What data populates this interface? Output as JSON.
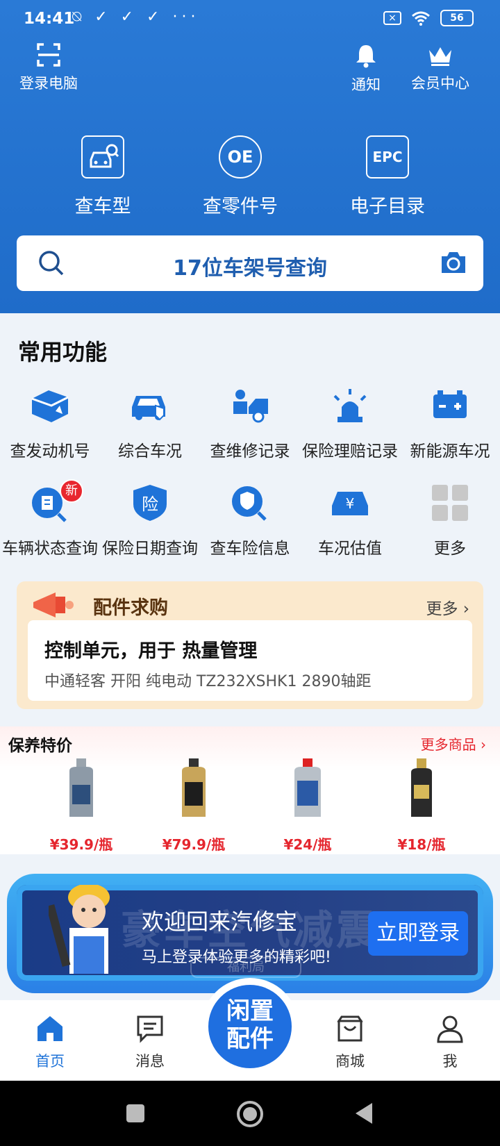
{
  "status": {
    "time": "14:41",
    "left_icons": "⍉ ✓ ✓ ✓ ···",
    "battery": "56"
  },
  "topnav": {
    "login_pc": "登录电脑",
    "notify": "通知",
    "member": "会员中心"
  },
  "quick": [
    {
      "label": "查车型",
      "icon_text": ""
    },
    {
      "label": "查零件号",
      "icon_text": "OE"
    },
    {
      "label": "电子目录",
      "icon_text": "EPC"
    }
  ],
  "search": {
    "text": "17位车架号查询"
  },
  "common": {
    "title": "常用功能",
    "row1": [
      "查发动机号",
      "综合车况",
      "查维修记录",
      "保险理赔记录",
      "新能源车况"
    ],
    "row2": [
      "车辆状态查询",
      "保险日期查询",
      "查车险信息",
      "车况估值",
      "更多"
    ],
    "badge": "新"
  },
  "parts": {
    "title": "配件求购",
    "more": "更多 ›",
    "item_title": "控制单元，用于 热量管理",
    "item_sub": "中通轻客 开阳 纯电动 TZ232XSHK1 2890轴距"
  },
  "maintenance": {
    "title": "保养特价",
    "more": "更多商品 ›",
    "prices": [
      "¥39.9/瓶",
      "¥79.9/瓶",
      "¥24/瓶",
      "¥18/瓶"
    ]
  },
  "banner": {
    "bg_text": "豪车空气减震",
    "welcome": "欢迎回来汽修宝",
    "sub": "马上登录体验更多的精彩吧!",
    "login_btn": "立即登录",
    "tag": "福利局"
  },
  "tabbar": {
    "home": "首页",
    "messages": "消息",
    "center": "闲置配件",
    "shop": "商城",
    "me": "我"
  },
  "colors": {
    "primary": "#1f6cc9",
    "accent_red": "#e5262e",
    "tab_active": "#1f73d8"
  }
}
